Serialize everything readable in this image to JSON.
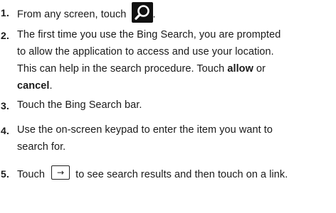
{
  "steps": [
    {
      "number": "1.",
      "lines": [
        {
          "text_before": "From any screen, touch ",
          "text_after": "."
        }
      ]
    },
    {
      "number": "2.",
      "lines": [
        {
          "text": "The first time you use the Bing Search, you are prompted"
        },
        {
          "text": "to allow the application to access and use your location."
        },
        {
          "text": "This can help in the search procedure. Touch ",
          "bold": "allow",
          "text_after": " or"
        },
        {
          "bold": "cancel",
          "text_after": "."
        }
      ]
    },
    {
      "number": "3.",
      "lines": [
        {
          "text": "Touch the Bing Search bar."
        }
      ]
    },
    {
      "number": "4.",
      "lines": [
        {
          "text": "Use the on-screen keypad to enter the item you want to"
        },
        {
          "text": "search for."
        }
      ]
    },
    {
      "number": "5.",
      "lines": [
        {
          "text_before": "Touch ",
          "key_symbol": "→",
          "text_after": " to see search results and then touch on a link."
        }
      ]
    }
  ],
  "icons": {
    "search": "search-icon",
    "arrow_key": "right-arrow-key-icon"
  }
}
